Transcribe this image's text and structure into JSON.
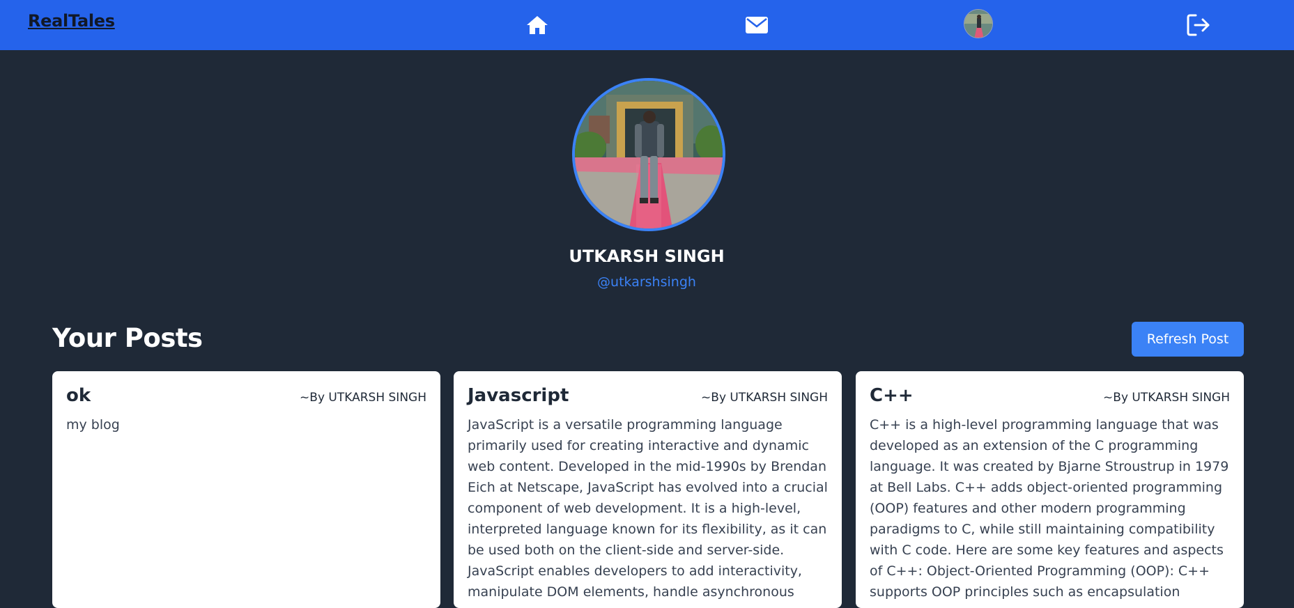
{
  "navbar": {
    "brand": "RealTales",
    "icons": [
      "home-icon",
      "mail-icon",
      "user-avatar",
      "logout-icon"
    ],
    "bg_color": "#2563eb"
  },
  "profile": {
    "name": "UTKARSH SINGH",
    "handle": "@utkarshsingh",
    "accent_color": "#3b82f6"
  },
  "posts_section": {
    "title": "Your Posts",
    "refresh_label": "Refresh Post"
  },
  "posts": [
    {
      "title": "ok",
      "author": "~By UTKARSH SINGH",
      "body": "my blog"
    },
    {
      "title": "Javascript",
      "author": "~By UTKARSH SINGH",
      "body": "JavaScript is a versatile programming language primarily used for creating interactive and dynamic web content. Developed in the mid-1990s by Brendan Eich at Netscape, JavaScript has evolved into a crucial component of web development. It is a high-level, interpreted language known for its flexibility, as it can be used both on the client-side and server-side. JavaScript enables developers to add interactivity, manipulate DOM elements, handle asynchronous"
    },
    {
      "title": "C++",
      "author": "~By UTKARSH SINGH",
      "body": "C++ is a high-level programming language that was developed as an extension of the C programming language. It was created by Bjarne Stroustrup in 1979 at Bell Labs. C++ adds object-oriented programming (OOP) features and other modern programming paradigms to C, while still maintaining compatibility with C code. Here are some key features and aspects of C++: Object-Oriented Programming (OOP): C++ supports OOP principles such as encapsulation"
    }
  ]
}
